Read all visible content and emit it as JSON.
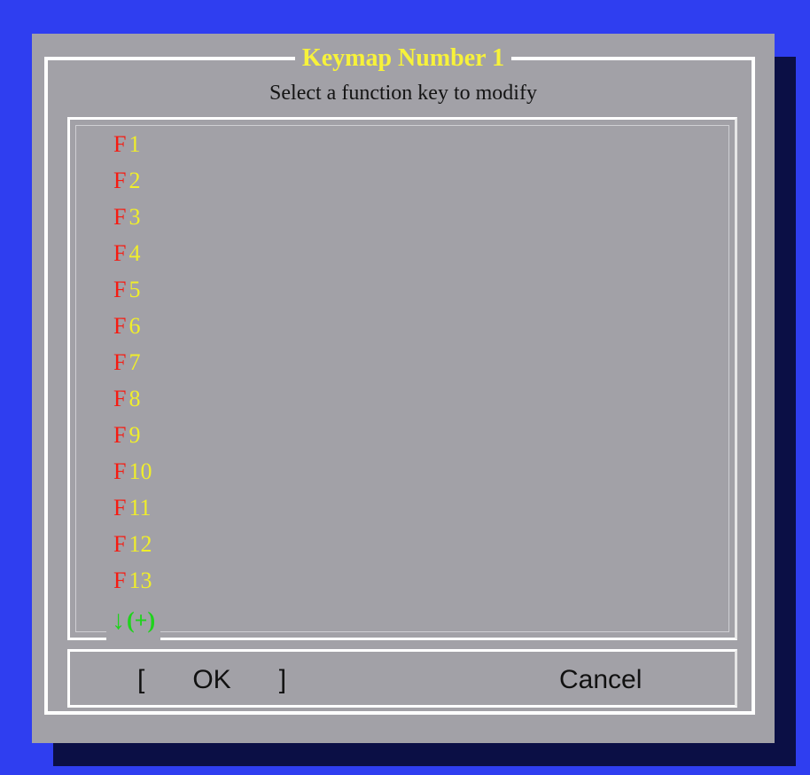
{
  "dialog": {
    "title": "Keymap Number 1",
    "subtitle": "Select a function key to modify"
  },
  "keys": [
    {
      "letter": "F",
      "number": "1"
    },
    {
      "letter": "F",
      "number": "2"
    },
    {
      "letter": "F",
      "number": "3"
    },
    {
      "letter": "F",
      "number": "4"
    },
    {
      "letter": "F",
      "number": "5"
    },
    {
      "letter": "F",
      "number": "6"
    },
    {
      "letter": "F",
      "number": "7"
    },
    {
      "letter": "F",
      "number": "8"
    },
    {
      "letter": "F",
      "number": "9"
    },
    {
      "letter": "F",
      "number": "10"
    },
    {
      "letter": "F",
      "number": "11"
    },
    {
      "letter": "F",
      "number": "12"
    },
    {
      "letter": "F",
      "number": "13"
    }
  ],
  "more_indicator": {
    "arrow": "↓",
    "text": "(+)",
    "icon": "down-arrow-icon"
  },
  "buttons": {
    "ok_left_bracket": "[",
    "ok_label": "OK",
    "ok_right_bracket": "]",
    "cancel_label": "Cancel"
  },
  "colors": {
    "desktop": "#2f3ef0",
    "dialog": "#a2a1a7",
    "title": "#f7f23a",
    "key_letter": "#f51b12",
    "key_number": "#f0ee2a",
    "indicator": "#1fd31c"
  }
}
